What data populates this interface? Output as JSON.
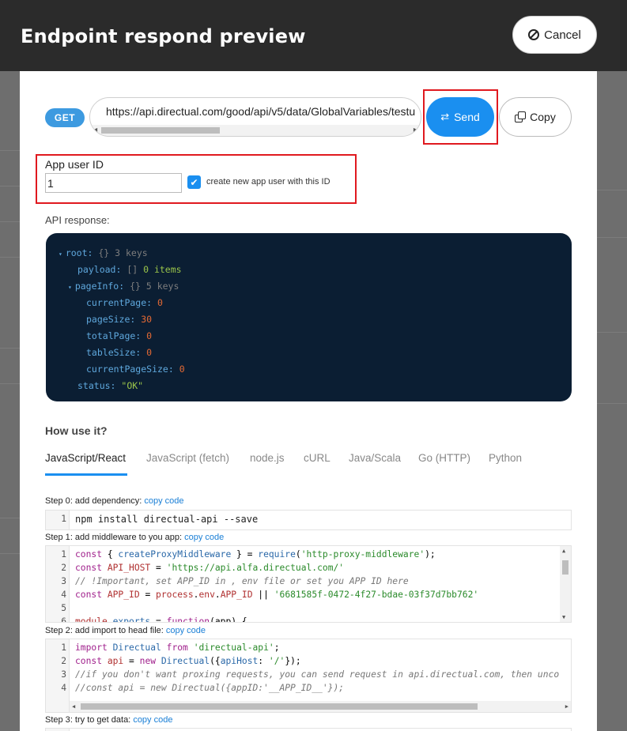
{
  "modal": {
    "title": "Endpoint respond preview",
    "cancel_label": "Cancel"
  },
  "request": {
    "method": "GET",
    "url": "https://api.directual.com/good/api/v5/data/GlobalVariables/testu",
    "send_label": "Send",
    "copy_label": "Copy"
  },
  "app_user": {
    "label": "App user ID",
    "value": "1",
    "checkbox_label": "create new app user with this ID",
    "checkbox_checked": true
  },
  "api_response": {
    "label": "API response:",
    "lines": [
      {
        "toggle": "▾",
        "key": "root:",
        "sep": " {}",
        "meta": " 3 keys"
      },
      {
        "toggle": "",
        "key": "payload:",
        "sep": " []",
        "num": " 0",
        "meta": " items"
      },
      {
        "toggle": "▾",
        "key": "pageInfo:",
        "sep": " {}",
        "meta": " 5 keys"
      },
      {
        "key": "currentPage:",
        "num": " 0"
      },
      {
        "key": "pageSize:",
        "num": " 30"
      },
      {
        "key": "totalPage:",
        "num": " 0"
      },
      {
        "key": "tableSize:",
        "num": " 0"
      },
      {
        "key": "currentPageSize:",
        "num": " 0"
      },
      {
        "key": "status:",
        "str": " \"OK\""
      }
    ]
  },
  "how_to": {
    "title": "How use it?",
    "tabs": [
      "JavaScript/React",
      "JavaScript (fetch)",
      "node.js",
      "cURL",
      "Java/Scala",
      "Go (HTTP)",
      "Python"
    ],
    "active_tab": "JavaScript/React",
    "copy_code_label": "copy code",
    "steps": [
      {
        "label": "Step 0",
        "text": ": add dependency: "
      },
      {
        "label": "Step 1",
        "text": ": add middleware to you app: "
      },
      {
        "label": "Step 2",
        "text": ": add import to head file: "
      },
      {
        "label": "Step 3",
        "text": ": try to get data: "
      }
    ],
    "step0_code": [
      "npm install directual-api --save"
    ],
    "step1_code": [
      "const { createProxyMiddleware } = require('http-proxy-middleware');",
      "const API_HOST = 'https://api.alfa.directual.com/'",
      "// !Important, set APP_ID in , env file or set you APP ID here",
      "const APP_ID = process.env.APP_ID || '6681585f-0472-4f27-bdae-03f37d7bb762'",
      "",
      "module.exports = function(app) {"
    ],
    "step2_code": [
      "import Directual from 'directual-api';",
      "const api = new Directual({apiHost: '/'});",
      "//if you don't want proxing requests, you can send request in api.directual.com, then unco",
      "//const api = new Directual({appID:'__APP_ID__'});"
    ]
  },
  "colors": {
    "accent": "#1a8ff0",
    "highlight_border": "#e0191f",
    "json_bg": "#0b1e33"
  }
}
